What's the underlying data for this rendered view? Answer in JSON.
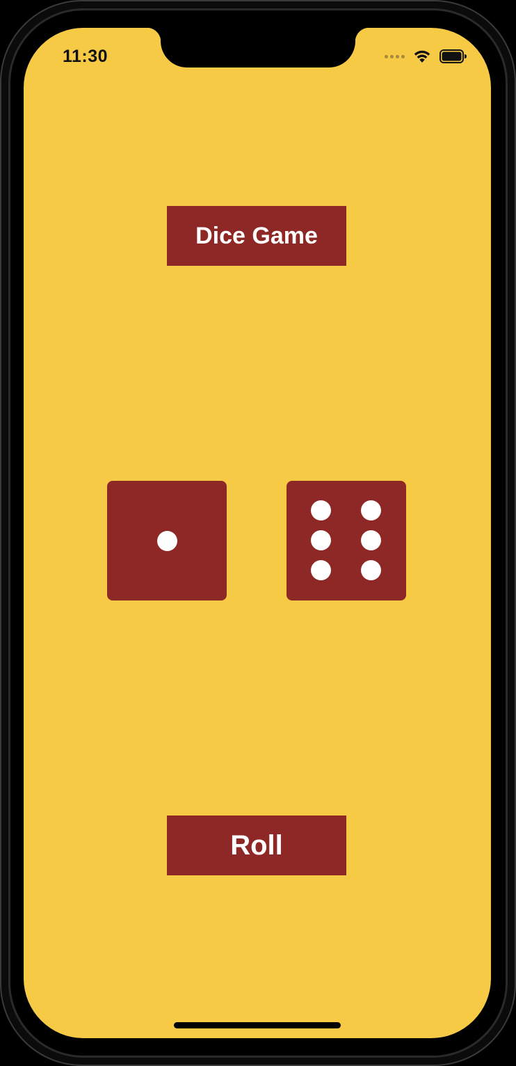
{
  "status_bar": {
    "time": "11:30",
    "icons": [
      "signal-dots-icon",
      "wifi-icon",
      "battery-icon"
    ]
  },
  "app": {
    "title": "Dice Game",
    "roll_label": "Roll",
    "dice": [
      {
        "name": "left-die",
        "value": 1
      },
      {
        "name": "right-die",
        "value": 6
      }
    ]
  },
  "colors": {
    "background": "#F7CA46",
    "accent": "#8E2826",
    "pip": "#FFFFFF"
  }
}
